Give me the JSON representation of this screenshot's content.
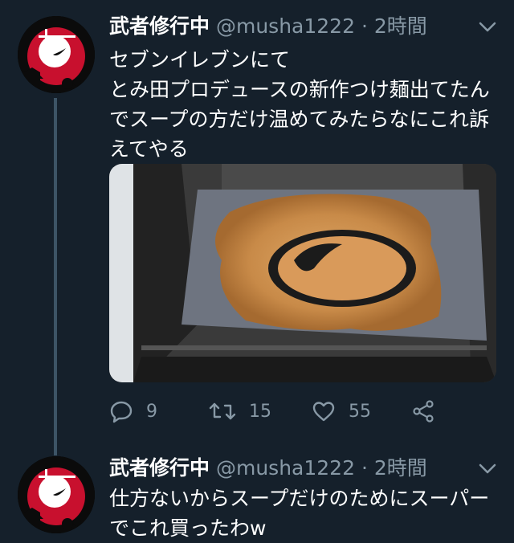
{
  "tweets": [
    {
      "display_name": "武者修行中",
      "handle": "@musha1222",
      "separator": "·",
      "time": "2時間",
      "text": "セブンイレブンにて\nとみ田プロデュースの新作つけ麺出てたんでスープの方だけ温めてみたらなにこれ訴えてやる",
      "stats": {
        "replies": "9",
        "retweets": "15",
        "likes": "55"
      }
    },
    {
      "display_name": "武者修行中",
      "handle": "@musha1222",
      "separator": "·",
      "time": "2時間",
      "text": "仕方ないからスープだけのためにスーパーでこれ買ったわw"
    }
  ],
  "icons": {
    "reply": "reply-icon",
    "retweet": "retweet-icon",
    "like": "heart-icon",
    "share": "share-icon",
    "more": "chevron-down-icon"
  },
  "colors": {
    "background": "#15202b",
    "secondary_text": "#8899a6",
    "thread_line": "#3d5466",
    "avatar_red": "#c8102e"
  }
}
